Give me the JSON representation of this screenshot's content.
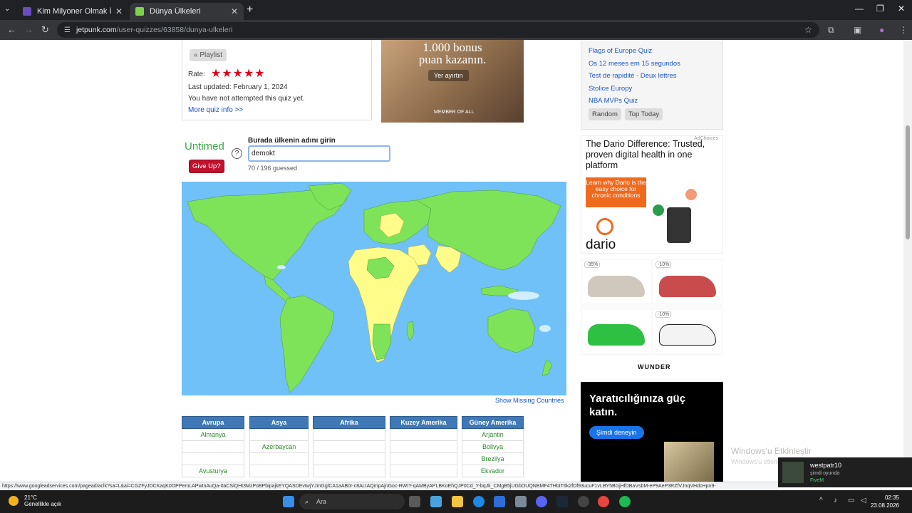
{
  "browser": {
    "tabs": [
      {
        "title": "Kim Milyoner Olmak İster? - Qu",
        "active": false
      },
      {
        "title": "Dünya Ülkeleri",
        "active": true
      }
    ],
    "url_domain": "jetpunk.com",
    "url_path": "/user-quizzes/63858/dunya-ulkeleri"
  },
  "quiz_info": {
    "playlist_label": "« Playlist",
    "rate_label": "Rate:",
    "stars": 5,
    "last_updated": "Last updated: February 1, 2024",
    "attempt_status": "You have not attempted this quiz yet.",
    "more_info_link": "More quiz info >>"
  },
  "ad_top": {
    "headline": "1.000 bonus puan kazanın.",
    "cta": "Yer ayırtın",
    "brand": "MEMBER OF ALL"
  },
  "right_list": {
    "links": [
      "Flags of Europe Quiz",
      "Os 12 meses em 15 segundos",
      "Test de rapidité - Deux lettres",
      "Stolice Europy",
      "NBA MVPs Quiz"
    ],
    "buttons": [
      "Random",
      "Top Today"
    ]
  },
  "quiz": {
    "mode": "Untimed",
    "give_up": "Give Up?",
    "prompt": "Burada ülkenin adını girin",
    "answer_value": "demokt",
    "progress": "70 / 196 guessed",
    "show_missing": "Show Missing Countries"
  },
  "colors": {
    "ocean": "#6fc1f7",
    "guessed": "#7fe35a",
    "missing": "#fffc8a",
    "table_header": "#3f78b5",
    "give_up": "#c0112d",
    "untimed": "#3aa84a"
  },
  "answer_tables": [
    {
      "header": "Avrupa",
      "rows": [
        "Almanya",
        "",
        "",
        "Avusturya"
      ]
    },
    {
      "header": "Asya",
      "rows": [
        "",
        "Azerbaycan",
        "",
        ""
      ]
    },
    {
      "header": "Afrika",
      "rows": [
        "",
        "",
        "",
        ""
      ]
    },
    {
      "header": "Kuzey Amerika",
      "rows": [
        "",
        "",
        "",
        ""
      ]
    },
    {
      "header": "Güney Amerika",
      "rows": [
        "Arjantin",
        "Bolivya",
        "Brezilya",
        "Ekvador"
      ]
    }
  ],
  "ad_dario": {
    "title": "The Dario Difference: Trusted, proven digital health in one platform",
    "cta": "Learn why Dario is the easy choice for chronic conditions",
    "logo": "dario",
    "adchoices": "AdChoices"
  },
  "ad_shoes": {
    "tags": [
      "-35%",
      "-10%",
      "",
      "-10%"
    ],
    "brand": "WUNDER"
  },
  "ad_dark": {
    "title": "Yaratıcılığınıza güç katın.",
    "cta": "Şimdi deneyin"
  },
  "windows_watermark": {
    "line1": "Windows'u Etkinleştir",
    "line2": "Windows'u etkinleştirmek için Ayarlar'a gidin."
  },
  "notification": {
    "name": "westpatr10",
    "status": "şimdi oyunda",
    "game": "FiveM"
  },
  "status_url": "https://www.googleadservices.com/pagead/aclk?sa=L&ai=CGZFyJDCKaqK0OPPemLAPwtnAuQa-0aCSiQHt3MzPoBPbipajkEYQASDEvtwjYJmGglCA1aAB0r-c8ALIAQmpAjnGoc-RWIY-qAMByAPLBKoEhQJP0Cd_Y-bqJk_CMgB5jUGbOUQNBMF4THbIT6k2fDf93ucuF1vLBY5BGjHfDBaVsbM-eP9AeP3RZfVJnqVHdcHpn9-",
  "taskbar": {
    "weather_temp": "21°C",
    "weather_desc": "Genellikle açık",
    "search_placeholder": "Ara",
    "time": "02:35",
    "date": "23.08.2026"
  }
}
